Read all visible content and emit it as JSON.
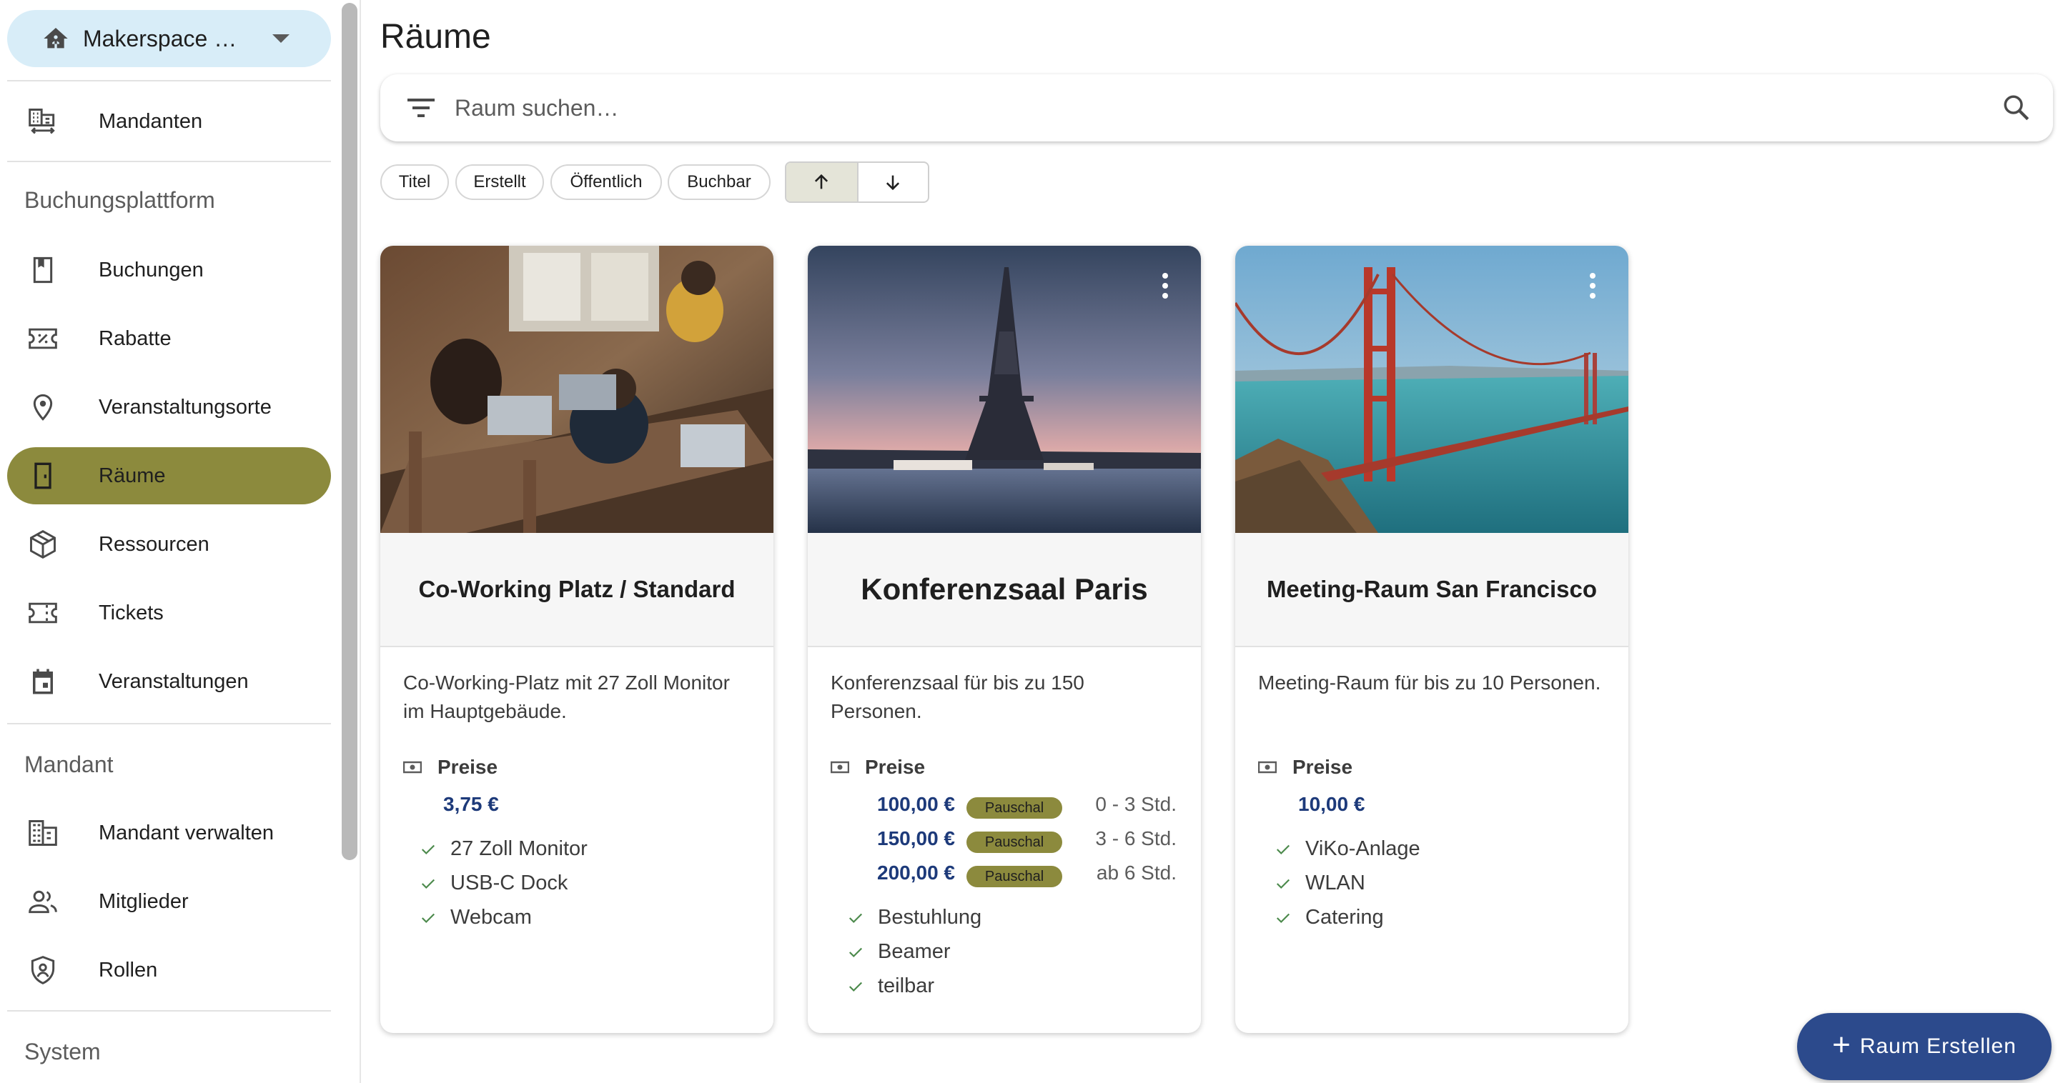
{
  "sidebar": {
    "tenant_select": {
      "label": "Makerspace …",
      "icon": "home-icon"
    },
    "top_items": [
      {
        "label": "Mandanten",
        "icon": "domain-switch-icon"
      }
    ],
    "sections": [
      {
        "title": "Buchungsplattform",
        "items": [
          {
            "label": "Buchungen",
            "icon": "bookmark-icon"
          },
          {
            "label": "Rabatte",
            "icon": "discount-ticket-icon"
          },
          {
            "label": "Veranstaltungsorte",
            "icon": "location-pin-icon"
          },
          {
            "label": "Räume",
            "icon": "door-icon",
            "active": true
          },
          {
            "label": "Ressourcen",
            "icon": "cube-icon"
          },
          {
            "label": "Tickets",
            "icon": "ticket-icon"
          },
          {
            "label": "Veranstaltungen",
            "icon": "calendar-icon"
          }
        ]
      },
      {
        "title": "Mandant",
        "items": [
          {
            "label": "Mandant verwalten",
            "icon": "building-icon"
          },
          {
            "label": "Mitglieder",
            "icon": "people-icon"
          },
          {
            "label": "Rollen",
            "icon": "shield-user-icon"
          }
        ]
      },
      {
        "title": "System",
        "items": []
      }
    ]
  },
  "main": {
    "title": "Räume",
    "search": {
      "placeholder": "Raum suchen…",
      "value": ""
    },
    "sort_chips": [
      "Titel",
      "Erstellt",
      "Öffentlich",
      "Buchbar"
    ],
    "sort_direction": {
      "active": "ascending",
      "icons": [
        "arrow-up-icon",
        "arrow-down-icon"
      ]
    },
    "prices_label": "Preise",
    "cards": [
      {
        "title": "Co-Working Platz / Standard",
        "image": "coworking-photo",
        "has_menu": false,
        "description": "Co-Working-Platz mit 27 Zoll Monitor im Hauptgebäude.",
        "prices": [
          {
            "amount": "3,75 €"
          }
        ],
        "features": [
          "27 Zoll Monitor",
          "USB-C Dock",
          "Webcam"
        ]
      },
      {
        "title": "Konferenzsaal Paris",
        "image": "eiffel-tower-photo",
        "has_menu": true,
        "description": "Konferenzsaal für bis zu 150 Personen.",
        "prices": [
          {
            "amount": "100,00 €",
            "badge": "Pauschal",
            "range": "0 - 3 Std."
          },
          {
            "amount": "150,00 €",
            "badge": "Pauschal",
            "range": "3 - 6 Std."
          },
          {
            "amount": "200,00 €",
            "badge": "Pauschal",
            "range": "ab 6 Std."
          }
        ],
        "features": [
          "Bestuhlung",
          "Beamer",
          "teilbar"
        ]
      },
      {
        "title": "Meeting-Raum San Francisco",
        "image": "golden-gate-photo",
        "has_menu": true,
        "description": "Meeting-Raum für bis zu 10 Personen.",
        "prices": [
          {
            "amount": "10,00 €"
          }
        ],
        "features": [
          "ViKo-Anlage",
          "WLAN",
          "Catering"
        ]
      }
    ],
    "fab": {
      "label": "Raum Erstellen",
      "icon": "plus-icon"
    }
  },
  "colors": {
    "accent_olive": "#8c8a3d",
    "primary_blue": "#2c4a8c",
    "price_blue": "#1d3a7a",
    "tenant_bg": "#d8edf8"
  }
}
